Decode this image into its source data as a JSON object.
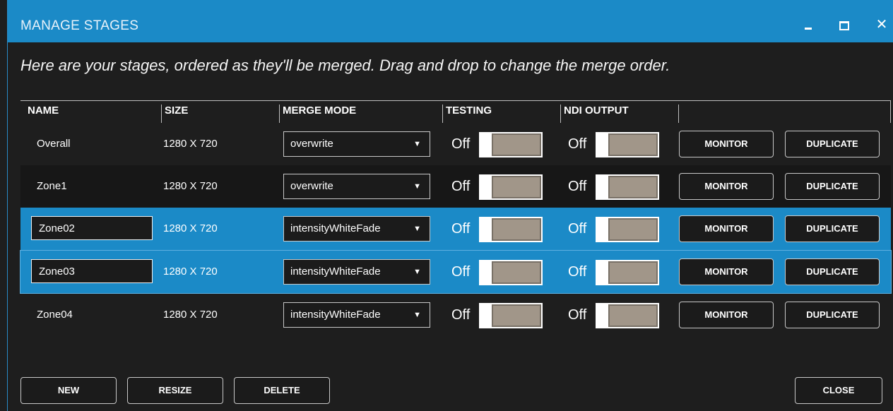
{
  "window": {
    "title": "MANAGE STAGES",
    "controls": {
      "minimize": "minimize",
      "maximize": "maximize",
      "close": "✕"
    }
  },
  "instructions": "Here are your stages, ordered as they'll be merged. Drag and drop to change the merge order.",
  "columns": {
    "name": "NAME",
    "size": "SIZE",
    "merge_mode": "MERGE MODE",
    "testing": "TESTING",
    "ndi_output": "NDI OUTPUT"
  },
  "rows": [
    {
      "name": "Overall",
      "size": "1280 X 720",
      "merge_mode": "overwrite",
      "testing": "Off",
      "ndi": "Off",
      "monitor": "MONITOR",
      "duplicate": "DUPLICATE",
      "editable": false,
      "selected": false
    },
    {
      "name": "Zone1",
      "size": "1280 X 720",
      "merge_mode": "overwrite",
      "testing": "Off",
      "ndi": "Off",
      "monitor": "MONITOR",
      "duplicate": "DUPLICATE",
      "editable": false,
      "selected": false
    },
    {
      "name": "Zone02",
      "size": "1280 X 720",
      "merge_mode": "intensityWhiteFade",
      "testing": "Off",
      "ndi": "Off",
      "monitor": "MONITOR",
      "duplicate": "DUPLICATE",
      "editable": true,
      "selected": true
    },
    {
      "name": "Zone03",
      "size": "1280 X 720",
      "merge_mode": "intensityWhiteFade",
      "testing": "Off",
      "ndi": "Off",
      "monitor": "MONITOR",
      "duplicate": "DUPLICATE",
      "editable": true,
      "selected": true
    },
    {
      "name": "Zone04",
      "size": "1280 X 720",
      "merge_mode": "intensityWhiteFade",
      "testing": "Off",
      "ndi": "Off",
      "monitor": "MONITOR",
      "duplicate": "DUPLICATE",
      "editable": false,
      "selected": false
    }
  ],
  "footer": {
    "new_label": "NEW",
    "resize_label": "RESIZE",
    "delete_label": "DELETE",
    "close_label": "CLOSE"
  },
  "colors": {
    "accent": "#1b8ac7",
    "background": "#1e1e1e",
    "toggle_track": "#a19689"
  }
}
